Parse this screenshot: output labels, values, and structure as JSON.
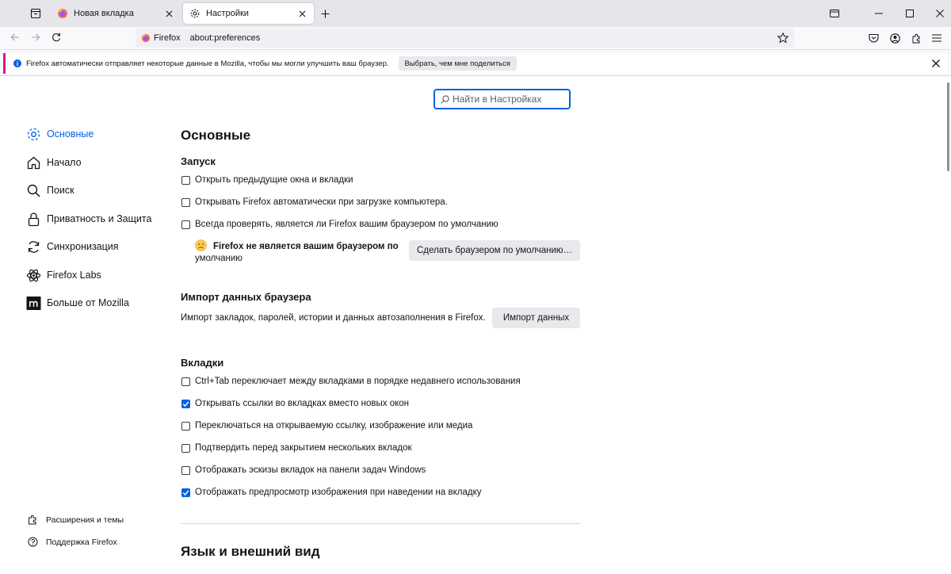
{
  "tabs": [
    {
      "title": "Новая вкладка",
      "active": false
    },
    {
      "title": "Настройки",
      "active": true
    }
  ],
  "urlbar": {
    "identity": "Firefox",
    "url": "about:preferences"
  },
  "notification": {
    "message": "Firefox автоматически отправляет некоторые данные в Mozilla, чтобы мы могли улучшить ваш браузер.",
    "button": "Выбрать, чем мне поделиться"
  },
  "search": {
    "placeholder": "Найти в Настройках"
  },
  "sidebar": {
    "categories": [
      {
        "label": "Основные",
        "icon": "gear-icon",
        "selected": true
      },
      {
        "label": "Начало",
        "icon": "home-icon"
      },
      {
        "label": "Поиск",
        "icon": "search-icon"
      },
      {
        "label": "Приватность и Защита",
        "icon": "lock-icon"
      },
      {
        "label": "Синхронизация",
        "icon": "sync-icon"
      },
      {
        "label": "Firefox Labs",
        "icon": "labs-icon"
      },
      {
        "label": "Больше от Mozilla",
        "icon": "mozilla-icon"
      }
    ],
    "footer": [
      {
        "label": "Расширения и темы",
        "icon": "extension-icon"
      },
      {
        "label": "Поддержка Firefox",
        "icon": "help-icon"
      }
    ]
  },
  "main": {
    "title": "Основные",
    "startup": {
      "heading": "Запуск",
      "options": [
        {
          "label": "Открыть предыдущие окна и вкладки",
          "checked": false
        },
        {
          "label": "Открывать Firefox автоматически при загрузке компьютера.",
          "checked": false
        },
        {
          "label": "Всегда проверять, является ли Firefox вашим браузером по умолчанию",
          "checked": false
        }
      ],
      "default_warning_bold": "Firefox не является вашим браузером по",
      "default_warning_rest": "умолчанию",
      "default_button": "Сделать браузером по умолчанию…"
    },
    "import": {
      "heading": "Импорт данных браузера",
      "description": "Импорт закладок, паролей, истории и данных автозаполнения в Firefox.",
      "button": "Импорт данных"
    },
    "tabs": {
      "heading": "Вкладки",
      "options": [
        {
          "label": "Ctrl+Tab переключает между вкладками в порядке недавнего использования",
          "checked": false
        },
        {
          "label": "Открывать ссылки во вкладках вместо новых окон",
          "checked": true
        },
        {
          "label": "Переключаться на открываемую ссылку, изображение или медиа",
          "checked": false
        },
        {
          "label": "Подтвердить перед закрытием нескольких вкладок",
          "checked": false
        },
        {
          "label": "Отображать эскизы вкладок на панели задач Windows",
          "checked": false
        },
        {
          "label": "Отображать предпросмотр изображения при наведении на вкладку",
          "checked": true
        }
      ]
    },
    "language_heading": "Язык и внешний вид"
  },
  "colors": {
    "accent": "#0061e0",
    "notification_stripe": "#e1127d"
  }
}
